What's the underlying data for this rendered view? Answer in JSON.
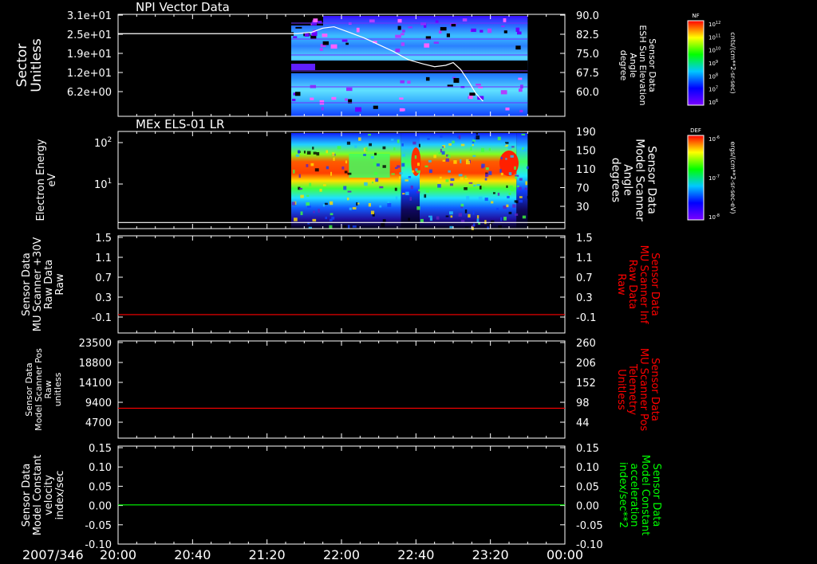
{
  "chart_data": [
    {
      "type": "heatmap",
      "title": "NPI Vector Data",
      "ylabel_left": [
        "Sector",
        "Unitless"
      ],
      "yticks_left": [
        "3.1e+01",
        "2.5e+01",
        "1.9e+01",
        "1.2e+01",
        "6.2e+00"
      ],
      "ylabel_right": [
        "Sensor Data",
        "ESH Sun Elevation",
        "Angle",
        "degree"
      ],
      "yticks_right": [
        "90.0",
        "82.5",
        "75.0",
        "67.5",
        "60.0"
      ],
      "yright_range": [
        53,
        90
      ],
      "line_series": {
        "name": "ESH Sun Elevation Angle",
        "x": [
          "20:00",
          "21:36",
          "21:44",
          "21:50",
          "21:56",
          "22:04",
          "22:12",
          "22:20",
          "22:28",
          "22:36",
          "22:44",
          "22:50",
          "22:56",
          "23:00",
          "23:04",
          "23:08",
          "23:12",
          "23:16"
        ],
        "y": [
          83.0,
          83.0,
          83.5,
          85.0,
          85.5,
          83.5,
          81.5,
          79.0,
          76.5,
          73.5,
          72.0,
          71.0,
          71.5,
          72.5,
          70.0,
          66.0,
          61.5,
          58.5
        ]
      },
      "colorbar": {
        "label": "NF",
        "units": "cnts/(cm**2-sr-sec)",
        "ticks": [
          "10^12",
          "10^11",
          "10^10",
          "10^9",
          "10^8",
          "10^7",
          "10^6"
        ]
      }
    },
    {
      "type": "heatmap",
      "title": "MEx ELS-01 LR",
      "ylabel_left": [
        "Electron Energy",
        "eV"
      ],
      "yticks_left": [
        "10^2",
        "10^1"
      ],
      "ylabel_right": [
        "Sensor Data",
        "Model Scanner",
        "Angle",
        "degrees"
      ],
      "yticks_right": [
        "190",
        "150",
        "110",
        "70",
        "30"
      ],
      "yright_range": [
        0,
        190
      ],
      "line_series": {
        "name": "Model Scanner Angle",
        "x": [
          "20:00",
          "00:00"
        ],
        "y": [
          12,
          12
        ]
      },
      "colorbar": {
        "label": "DEF",
        "units": "ergs/(cm**2-sr-sec-eV)",
        "ticks": [
          "10^-6",
          "10^-7",
          "10^-8"
        ]
      }
    },
    {
      "type": "line",
      "ylabel_left": [
        "Sensor Data",
        "MU Scanner +30V",
        "Raw Data",
        "Raw"
      ],
      "yticks_left": [
        "1.5",
        "1.1",
        "0.7",
        "0.3",
        "-0.1"
      ],
      "ylabel_right": [
        "Sensor Data",
        "MU Scanner Inf",
        "Raw Data",
        "Raw"
      ],
      "yticks_right": [
        "1.5",
        "1.1",
        "0.7",
        "0.3",
        "-0.1"
      ],
      "ylim": [
        -0.35,
        1.5
      ],
      "series": [
        {
          "name": "MU Scanner Inf Raw Data",
          "color": "#ff0000",
          "x": [
            "20:00",
            "00:00"
          ],
          "y": [
            0.0,
            0.0
          ]
        }
      ]
    },
    {
      "type": "line",
      "ylabel_left": [
        "Sensor Data",
        "Model Scanner Pos",
        "Raw",
        "unitless"
      ],
      "yticks_left": [
        "23500",
        "18800",
        "14100",
        "9400",
        "4700"
      ],
      "ylabel_right": [
        "Sensor Data",
        "MU Scanner Pos",
        "Telemetry",
        "Unitless"
      ],
      "yticks_right": [
        "260",
        "206",
        "152",
        "98",
        "44"
      ],
      "ylim": [
        0,
        23500
      ],
      "yright_range": [
        0,
        260
      ],
      "series": [
        {
          "name": "MU Scanner Pos Telemetry",
          "color": "#ff0000",
          "x": [
            "20:00",
            "00:00"
          ],
          "y_right": [
            80,
            80
          ]
        }
      ]
    },
    {
      "type": "line",
      "ylabel_left": [
        "Sensor Data",
        "Model Constant",
        "velocity",
        "index/sec"
      ],
      "yticks_left": [
        "0.15",
        "0.10",
        "0.05",
        "0.00",
        "-0.05",
        "-0.10"
      ],
      "ylabel_right": [
        "Sensor Data",
        "Model Constant",
        "acceleration",
        "index/sec**2"
      ],
      "yticks_right": [
        "0.15",
        "0.10",
        "0.05",
        "0.00",
        "-0.05",
        "-0.10"
      ],
      "ylim": [
        -0.1,
        0.15
      ],
      "series": [
        {
          "name": "Model Constant acceleration",
          "color": "#00ff00",
          "x": [
            "20:00",
            "00:00"
          ],
          "y": [
            0.0,
            0.0
          ]
        }
      ]
    }
  ],
  "xaxis": {
    "date_label": "2007/346",
    "ticks": [
      "20:00",
      "20:40",
      "21:20",
      "22:00",
      "22:40",
      "23:20",
      "00:00"
    ],
    "range": [
      "20:00",
      "00:00"
    ]
  },
  "data_window": [
    "21:33",
    "23:40"
  ],
  "colors": {
    "background": "#000000",
    "axis": "#ffffff",
    "red_series": "#ff0000",
    "green_series": "#00ff00"
  }
}
